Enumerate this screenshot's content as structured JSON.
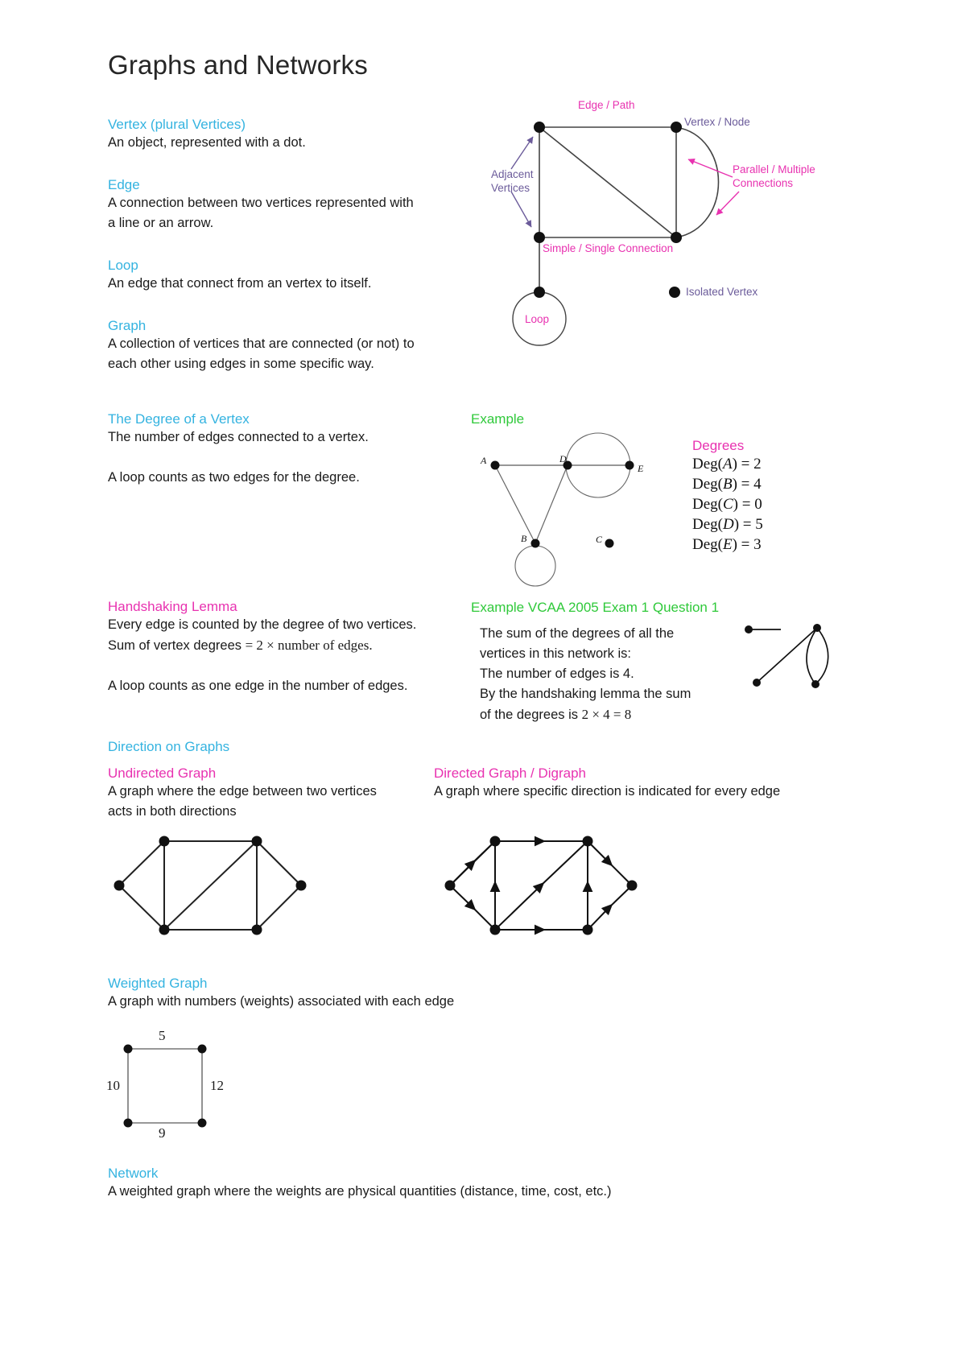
{
  "document": {
    "title": "Graphs and Networks"
  },
  "colors": {
    "heading_blue": "#34b3e0",
    "heading_pink": "#e832b0",
    "heading_green": "#2fc93a",
    "annotation_purple": "#6b5b9a",
    "body": "#1a1a1a"
  },
  "definitions": [
    {
      "term": "Vertex (plural Vertices)",
      "lines": [
        "An object, represented with a dot."
      ]
    },
    {
      "term": "Edge",
      "lines": [
        "A connection between two vertices represented with",
        "a line or an arrow."
      ]
    },
    {
      "term": "Loop",
      "lines": [
        "An edge that connect from an vertex to itself."
      ]
    },
    {
      "term": "Graph",
      "lines": [
        "A collection of vertices that are connected (or not) to",
        "each other using edges in some specific way."
      ]
    }
  ],
  "main_diagram": {
    "labels": {
      "edge_path": "Edge / Path",
      "vertex_node": "Vertex / Node",
      "parallel_line1": "Parallel / Multiple",
      "parallel_line2": "Connections",
      "adjacent_line1": "Adjacent",
      "adjacent_line2": "Vertices",
      "simple": "Simple / Single Connection",
      "loop": "Loop",
      "isolated": "Isolated Vertex"
    }
  },
  "degree_section": {
    "term": "The Degree of a Vertex",
    "lines": [
      "The number of edges connected to a vertex."
    ],
    "note": "A loop counts as two edges for the degree.",
    "example_label": "Example",
    "graph_vertices": [
      "A",
      "D",
      "E",
      "B",
      "C"
    ],
    "degrees_title": "Degrees",
    "degrees": [
      {
        "vertex": "A",
        "value": "2"
      },
      {
        "vertex": "B",
        "value": "4"
      },
      {
        "vertex": "C",
        "value": "0"
      },
      {
        "vertex": "D",
        "value": "5"
      },
      {
        "vertex": "E",
        "value": "3"
      }
    ]
  },
  "handshaking": {
    "term": "Handshaking Lemma",
    "line1": "Every edge is counted by the degree of two vertices.",
    "line2_prefix": "Sum of vertex degrees",
    "line2_math": "= 2 × number of edges.",
    "note": "A loop counts as one edge in the number of edges."
  },
  "vcaa_example": {
    "heading": "Example VCAA 2005 Exam 1 Question 1",
    "line1": "The sum of the degrees of all the",
    "line2": "vertices in this network is:",
    "line3": "The number of edges is 4.",
    "line4": "By the handshaking lemma the sum",
    "line5_prefix": "of the degrees is",
    "line5_math": "2 × 4 = 8"
  },
  "direction_section": {
    "heading": "Direction on Graphs",
    "undirected": {
      "term": "Undirected Graph",
      "lines": [
        "A graph where the edge between two vertices",
        "acts in both directions"
      ]
    },
    "directed": {
      "term": "Directed Graph / Digraph",
      "lines": [
        "A graph where specific direction is indicated for every edge"
      ]
    }
  },
  "weighted_section": {
    "term": "Weighted Graph",
    "lines": [
      "A graph with numbers (weights) associated with each edge"
    ],
    "weights": {
      "top": "5",
      "left": "10",
      "right": "12",
      "bottom": "9"
    }
  },
  "network_section": {
    "term": "Network",
    "lines": [
      "A weighted graph where the weights are physical quantities (distance, time, cost, etc.)"
    ]
  }
}
